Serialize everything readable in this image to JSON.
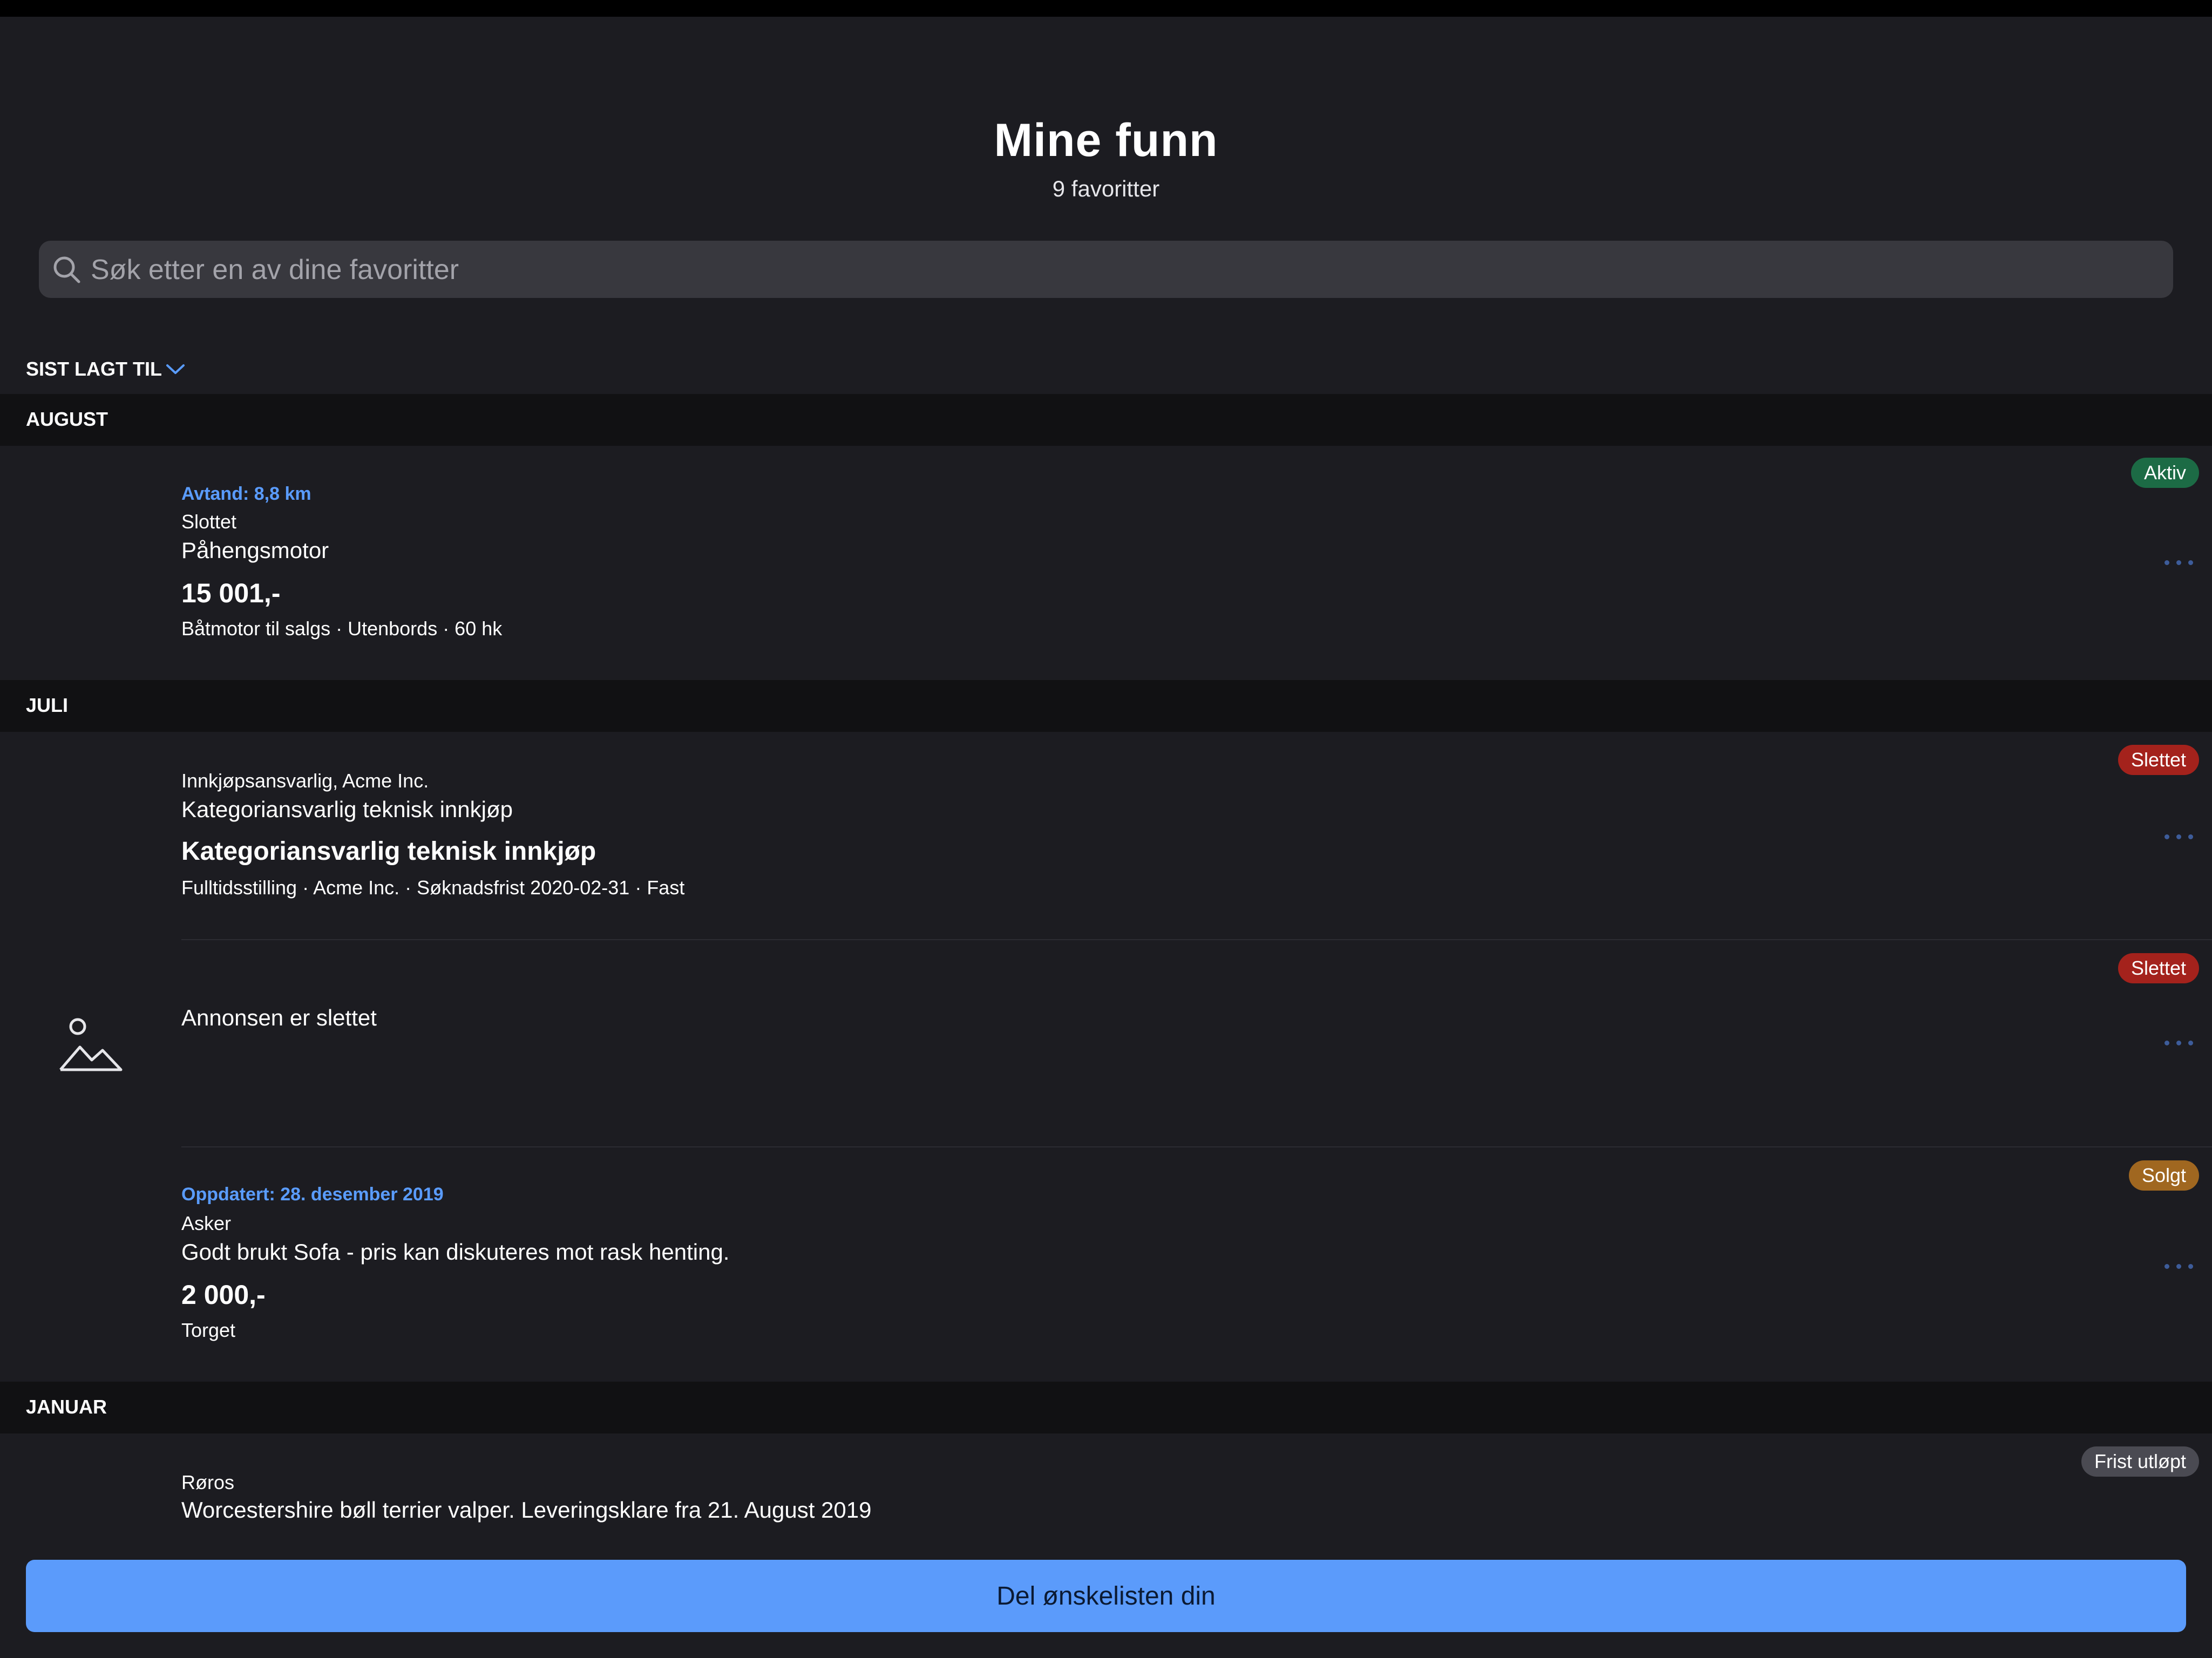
{
  "header": {
    "title": "Mine funn",
    "subtitle": "9 favoritter"
  },
  "search": {
    "placeholder": "Søk etter en av dine favoritter",
    "value": ""
  },
  "sort": {
    "label": "SIST LAGT TIL",
    "icon": "chevron-down-icon"
  },
  "sections": [
    {
      "label": "AUGUST"
    },
    {
      "label": "JULI"
    },
    {
      "label": "JANUAR"
    }
  ],
  "items": [
    {
      "meta": "Avtand: 8,8 km",
      "location": "Slottet",
      "title": "Påhengsmotor",
      "price": "15 001,-",
      "attrs": "Båtmotor til salgs · Utenbords · 60 hk",
      "badge": "Aktiv",
      "badge_color": "#1c6b45"
    },
    {
      "location": "Innkjøpsansvarlig, Acme Inc.",
      "title": "Kategoriansvarlig teknisk innkjøp",
      "heading": "Kategoriansvarlig teknisk innkjøp",
      "attrs": "Fulltidsstilling · Acme Inc. · Søknadsfrist 2020-02-31 · Fast",
      "badge": "Slettet",
      "badge_color": "#a4221c"
    },
    {
      "title": "Annonsen er slettet",
      "thumb_icon": "image-placeholder-icon",
      "badge": "Slettet",
      "badge_color": "#a4221c"
    },
    {
      "meta": "Oppdatert: 28. desember 2019",
      "location": "Asker",
      "title": "Godt brukt Sofa - pris kan diskuteres mot rask henting.",
      "price": "2 000,-",
      "attrs": "Torget",
      "badge": "Solgt",
      "badge_color": "#a06720"
    },
    {
      "location": "Røros",
      "title": "Worcestershire bøll terrier valper. Leveringsklare fra 21. August 2019",
      "badge": "Frist utløpt",
      "badge_color": "#4a4a52"
    }
  ],
  "footer": {
    "share_label": "Del ønskelisten din",
    "accent": "#5b9bfb"
  }
}
